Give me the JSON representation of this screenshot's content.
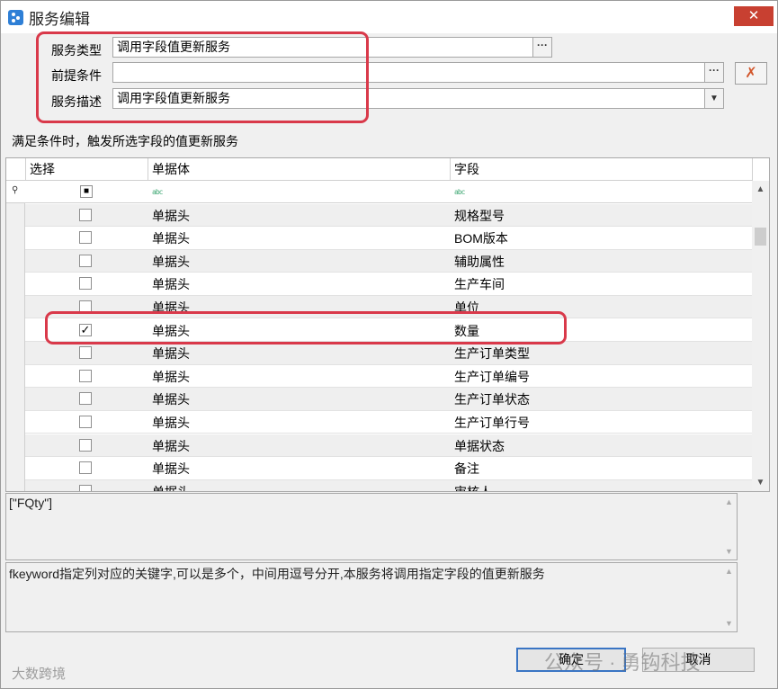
{
  "window": {
    "title": "服务编辑",
    "close_symbol": "✕"
  },
  "form": {
    "service_type": {
      "label": "服务类型",
      "value": "调用字段值更新服务"
    },
    "precondition": {
      "label": "前提条件",
      "value": ""
    },
    "description": {
      "label": "服务描述",
      "value": "调用字段值更新服务"
    },
    "ellipsis": "···"
  },
  "caption": "满足条件时，触发所选字段的值更新服务",
  "grid": {
    "columns": [
      "选择",
      "单据体",
      "字段"
    ],
    "filter_icon": "abc",
    "rows": [
      {
        "checked": false,
        "entity": "单据头",
        "field": "规格型号"
      },
      {
        "checked": false,
        "entity": "单据头",
        "field": "BOM版本"
      },
      {
        "checked": false,
        "entity": "单据头",
        "field": "辅助属性"
      },
      {
        "checked": false,
        "entity": "单据头",
        "field": "生产车间"
      },
      {
        "checked": false,
        "entity": "单据头",
        "field": "单位"
      },
      {
        "checked": true,
        "entity": "单据头",
        "field": "数量"
      },
      {
        "checked": false,
        "entity": "单据头",
        "field": "生产订单类型"
      },
      {
        "checked": false,
        "entity": "单据头",
        "field": "生产订单编号"
      },
      {
        "checked": false,
        "entity": "单据头",
        "field": "生产订单状态"
      },
      {
        "checked": false,
        "entity": "单据头",
        "field": "生产订单行号"
      },
      {
        "checked": false,
        "entity": "单据头",
        "field": "单据状态"
      },
      {
        "checked": false,
        "entity": "单据头",
        "field": "备注"
      },
      {
        "checked": false,
        "entity": "单据头",
        "field": "审核人"
      }
    ]
  },
  "json_box": {
    "value": "[\"FQty\"]"
  },
  "help_box": {
    "value": "fkeyword指定列对应的关键字,可以是多个，中间用逗号分开,本服务将调用指定字段的值更新服务"
  },
  "buttons": {
    "ok": "确定",
    "cancel": "取消"
  },
  "watermark": {
    "text": "公众号 · 勇钩科技",
    "bottom_left": "大数跨境"
  }
}
